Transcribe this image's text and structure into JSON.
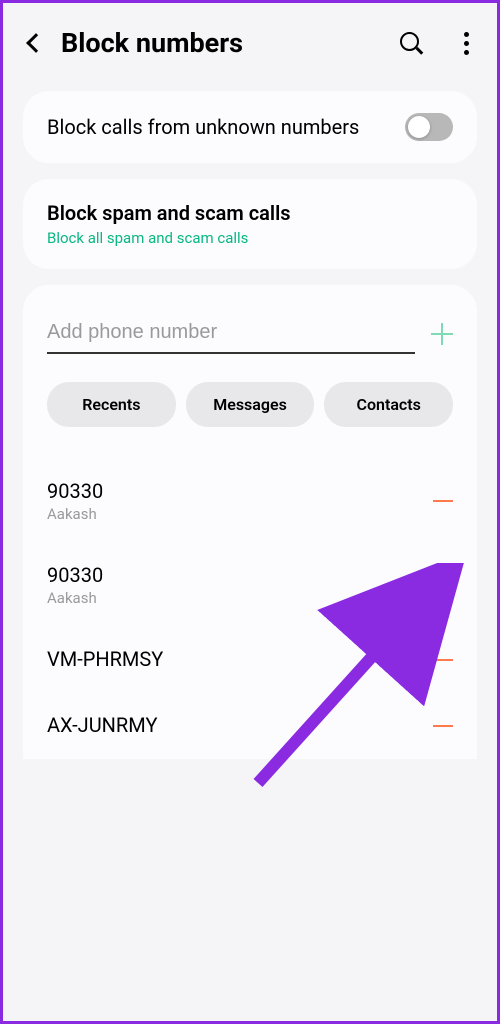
{
  "header": {
    "title": "Block numbers"
  },
  "toggle_card": {
    "label": "Block calls from unknown numbers"
  },
  "spam_card": {
    "title": "Block spam and scam calls",
    "subtitle": "Block all spam and scam calls"
  },
  "input": {
    "placeholder": "Add phone number"
  },
  "chips": {
    "recents": "Recents",
    "messages": "Messages",
    "contacts": "Contacts"
  },
  "blocked": [
    {
      "number": "90330",
      "name": "Aakash"
    },
    {
      "number": "90330",
      "name": "Aakash"
    },
    {
      "number": "VM-PHRMSY",
      "name": ""
    },
    {
      "number": "AX-JUNRMY",
      "name": ""
    }
  ]
}
